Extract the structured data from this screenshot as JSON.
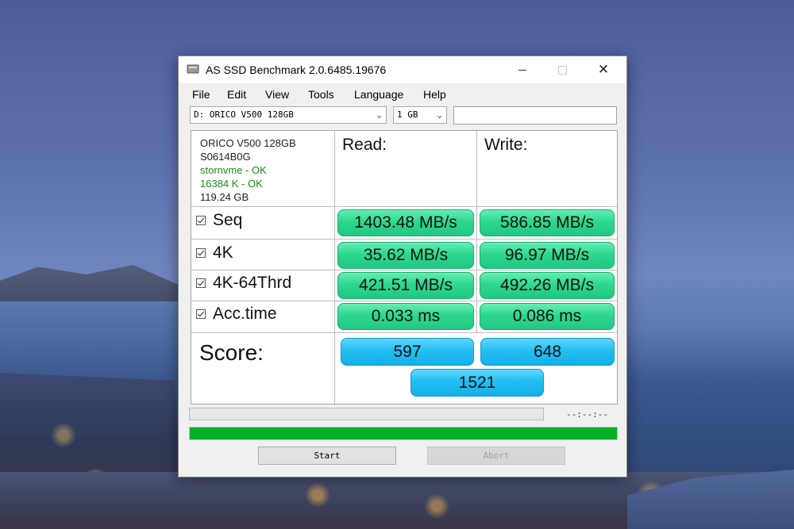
{
  "window": {
    "title": "AS SSD Benchmark 2.0.6485.19676"
  },
  "menu": [
    "File",
    "Edit",
    "View",
    "Tools",
    "Language",
    "Help"
  ],
  "toolbar": {
    "drive": "D: ORICO V500 128GB",
    "size": "1 GB",
    "text_value": ""
  },
  "info": {
    "model": "ORICO V500 128GB",
    "firmware": "S0614B0G",
    "driver": "stornvme - OK",
    "alignment": "16384 K - OK",
    "capacity": "119.24 GB"
  },
  "headers": {
    "read": "Read:",
    "write": "Write:"
  },
  "rows": [
    {
      "label": "Seq",
      "read": "1403.48 MB/s",
      "write": "586.85 MB/s",
      "checked": true
    },
    {
      "label": "4K",
      "read": "35.62 MB/s",
      "write": "96.97 MB/s",
      "checked": true
    },
    {
      "label": "4K-64Thrd",
      "read": "421.51 MB/s",
      "write": "492.26 MB/s",
      "checked": true
    },
    {
      "label": "Acc.time",
      "read": "0.033 ms",
      "write": "0.086 ms",
      "checked": true
    }
  ],
  "score": {
    "label": "Score:",
    "read": "597",
    "write": "648",
    "total": "1521"
  },
  "status": {
    "time": "--:--:--",
    "progress_fraction": 1.0
  },
  "buttons": {
    "start": "Start",
    "abort": "Abort"
  },
  "colors": {
    "result_green": "#2ed78f",
    "score_blue": "#22bff2",
    "progress_green": "#06b025",
    "ok_text": "#1a8a1a"
  }
}
